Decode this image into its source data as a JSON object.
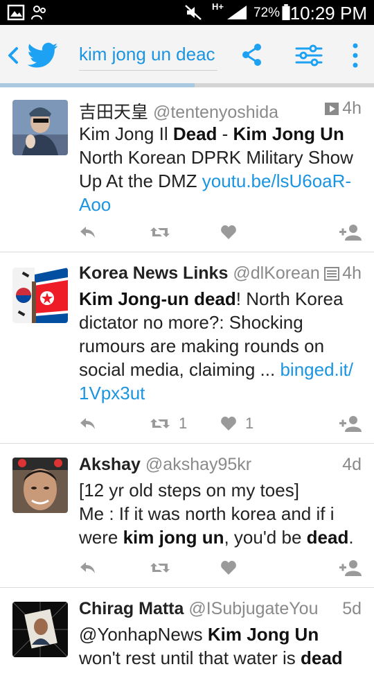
{
  "status_bar": {
    "battery": "72%",
    "time": "10:29 PM",
    "network": "H+"
  },
  "app_bar": {
    "search_query": "kim jong un deac",
    "search_progress": 0.52,
    "brand_color": "#1da1f2"
  },
  "tweets": [
    {
      "display_name": "吉田天皇",
      "handle": "@tentenyoshida",
      "time": "4h",
      "media_icon": "video-icon",
      "body_html": "Kim Jong Il <b>Dead</b> - <b>Kim Jong Un</b> North Korean DPRK Military Show Up At the DMZ <a>youtu.be/lsU6oaR-Aoo</a>",
      "retweets": "",
      "likes": ""
    },
    {
      "display_name": "Korea News Links",
      "handle": "@dlKoreane...",
      "time": "4h",
      "media_icon": "article-icon",
      "body_html": "<b>Kim Jong-un dead</b>! North Korea dictator no more?: Shocking rumours are making rounds on social media, claiming ... <a>binged.it/ 1Vpx3ut</a>",
      "retweets": "1",
      "likes": "1"
    },
    {
      "display_name": "Akshay",
      "handle": "@akshay95kr",
      "time": "4d",
      "media_icon": "",
      "body_html": "[12 yr old steps on my toes]<br>Me : If it was north korea and if i were <b>kim jong un</b>, you'd be <b>dead</b>.",
      "retweets": "",
      "likes": ""
    },
    {
      "display_name": "Chirag Matta",
      "handle": "@ISubjugateYou",
      "time": "5d",
      "media_icon": "",
      "body_html": "@YonhapNews <b>Kim Jong Un</b> won't rest until that water is <b>dead</b>",
      "retweets": "",
      "likes": ""
    }
  ]
}
